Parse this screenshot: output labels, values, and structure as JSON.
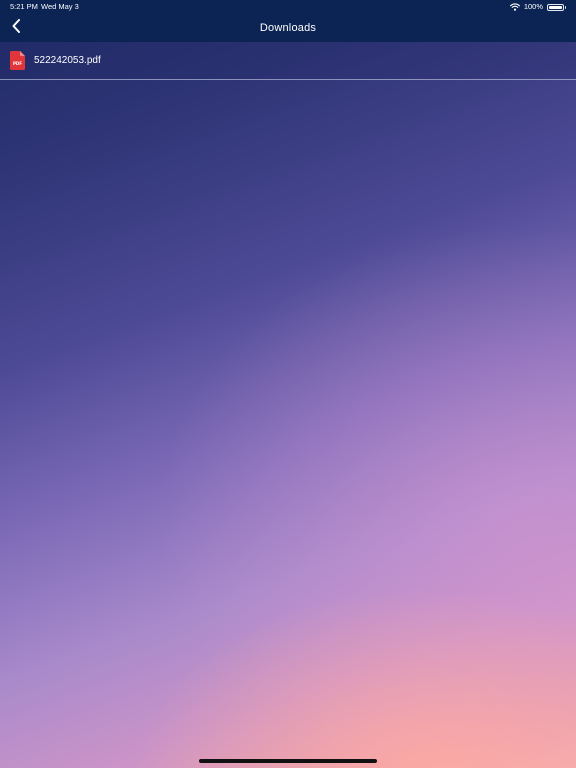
{
  "status_bar": {
    "time": "5:21 PM",
    "date": "Wed May 3",
    "battery": "100%",
    "battery_level": 1.0,
    "icons": [
      "wifi-icon",
      "battery-icon"
    ]
  },
  "nav": {
    "title": "Downloads",
    "back_icon": "chevron-left-icon"
  },
  "files": [
    {
      "name": "522242053.pdf",
      "icon": "pdf-file-icon",
      "icon_label": "PDF"
    }
  ],
  "colors": {
    "nav_background": "#0b2454",
    "pdf_red": "#e0353a",
    "text": "#ffffff"
  }
}
